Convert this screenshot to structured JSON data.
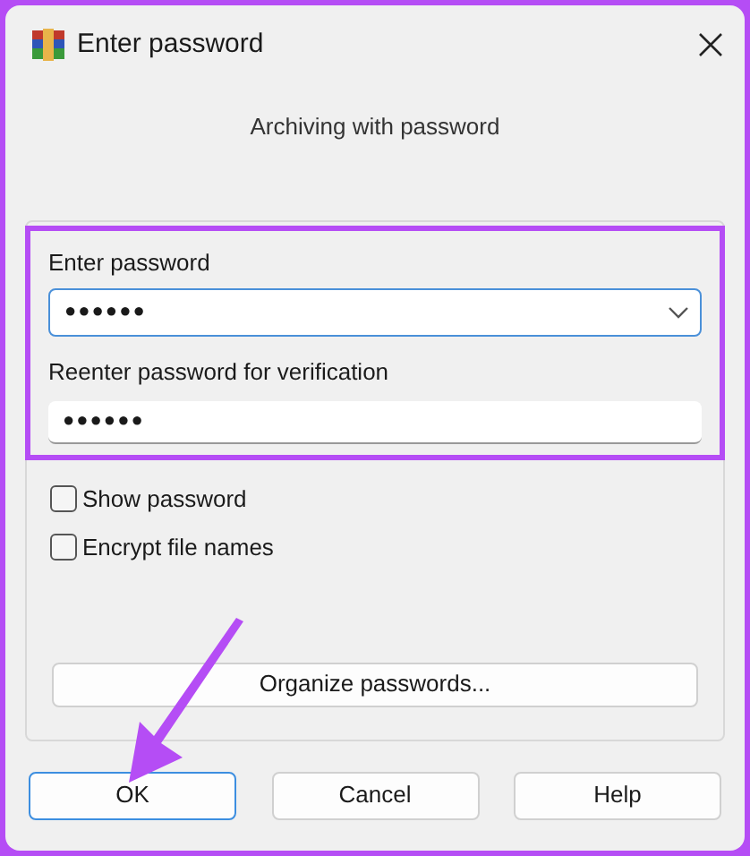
{
  "window": {
    "title": "Enter password"
  },
  "subtitle": "Archiving with password",
  "password": {
    "label": "Enter password",
    "value": "●●●●●●"
  },
  "verify": {
    "label": "Reenter password for verification",
    "value": "●●●●●●"
  },
  "options": [
    {
      "label": "Show password",
      "checked": false
    },
    {
      "label": "Encrypt file names",
      "checked": false
    }
  ],
  "organize_button": "Organize passwords...",
  "buttons": [
    {
      "label": "OK",
      "selected": true
    },
    {
      "label": "Cancel",
      "selected": false
    },
    {
      "label": "Help",
      "selected": false
    }
  ]
}
